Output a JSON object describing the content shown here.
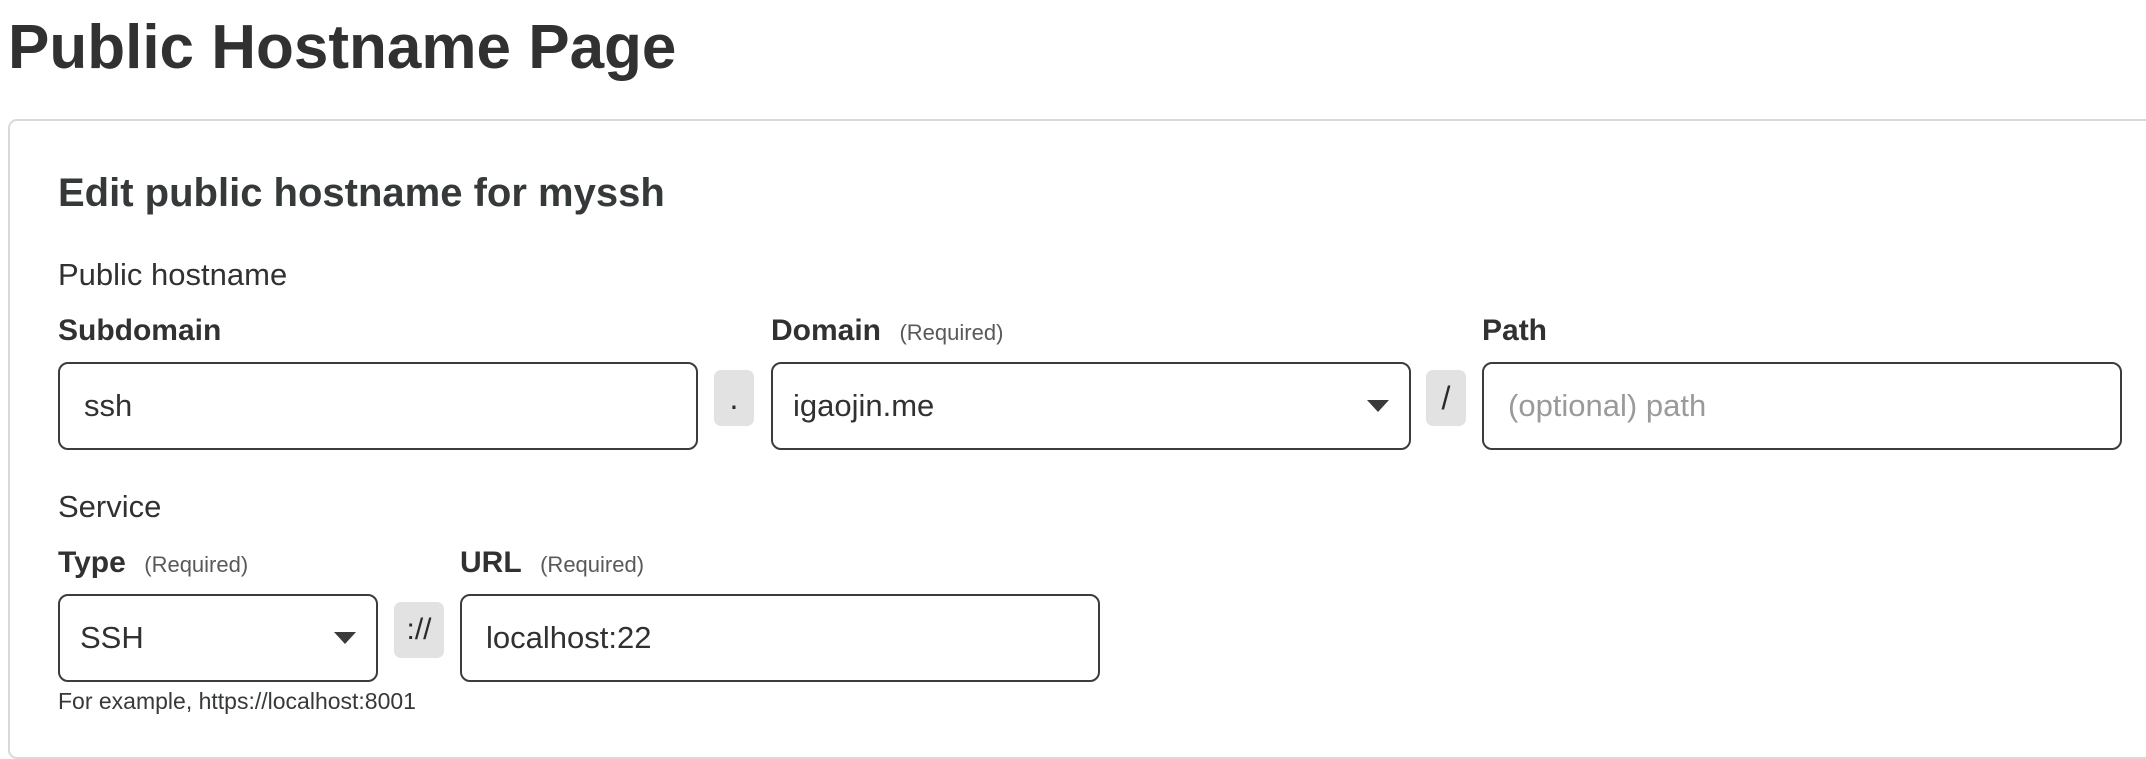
{
  "page": {
    "title": "Public Hostname Page"
  },
  "form": {
    "title": "Edit public hostname for myssh",
    "hostname_section": "Public hostname",
    "subdomain": {
      "label": "Subdomain",
      "value": "ssh"
    },
    "dot_separator": ".",
    "domain": {
      "label": "Domain",
      "required_note": "(Required)",
      "selected": "igaojin.me"
    },
    "slash_separator": "/",
    "path": {
      "label": "Path",
      "value": "",
      "placeholder": "(optional) path"
    },
    "service_section": "Service",
    "type": {
      "label": "Type",
      "required_note": "(Required)",
      "selected": "SSH"
    },
    "scheme_separator": "://",
    "url": {
      "label": "URL",
      "required_note": "(Required)",
      "value": "localhost:22"
    },
    "hint": "For example, https://localhost:8001"
  },
  "icons": {
    "domain_dropdown": "chevron-down-icon",
    "type_dropdown": "chevron-down-icon"
  },
  "colors": {
    "text": "#313131",
    "border": "#3c3c3c",
    "separator_bg": "#e2e2e2",
    "placeholder": "#9a9a9a"
  }
}
